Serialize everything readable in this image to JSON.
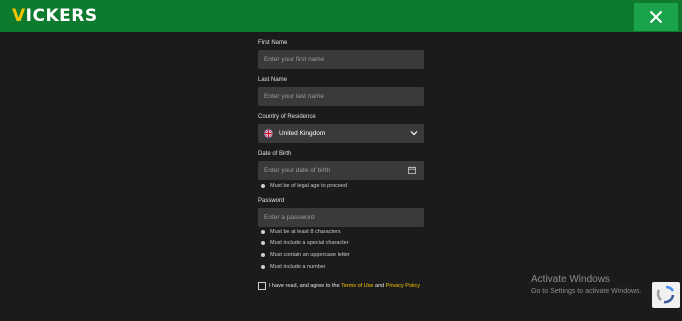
{
  "header": {
    "logo_first": "V",
    "logo_rest": "ICKERS",
    "close_icon": "close-icon"
  },
  "form": {
    "first_name": {
      "label": "First Name",
      "placeholder": "Enter your first name"
    },
    "last_name": {
      "label": "Last Name",
      "placeholder": "Enter your last name"
    },
    "country": {
      "label": "Country of Residence",
      "value": "United Kingdom",
      "icon": "uk-flag-icon"
    },
    "dob": {
      "label": "Date of Birth",
      "placeholder": "Enter your date of birth",
      "hint": "Must be of legal age to proceed"
    },
    "password": {
      "label": "Password",
      "placeholder": "Enter a password",
      "rules": [
        "Must be at least 8 characters",
        "Must include a special character",
        "Must contain an uppercase letter",
        "Must include a number"
      ]
    },
    "terms": {
      "prefix": "I have read, and agree to the ",
      "terms_link": "Terms of Use",
      "middle": " and ",
      "privacy_link": "Privacy Policy"
    }
  },
  "watermark": {
    "title": "Activate Windows",
    "subtitle": "Go to Settings to activate Windows."
  },
  "colors": {
    "header_bg": "#0e7a2e",
    "accent": "#f5c400",
    "field_bg": "#3a3a3a",
    "page_bg": "#1b1b1b"
  }
}
